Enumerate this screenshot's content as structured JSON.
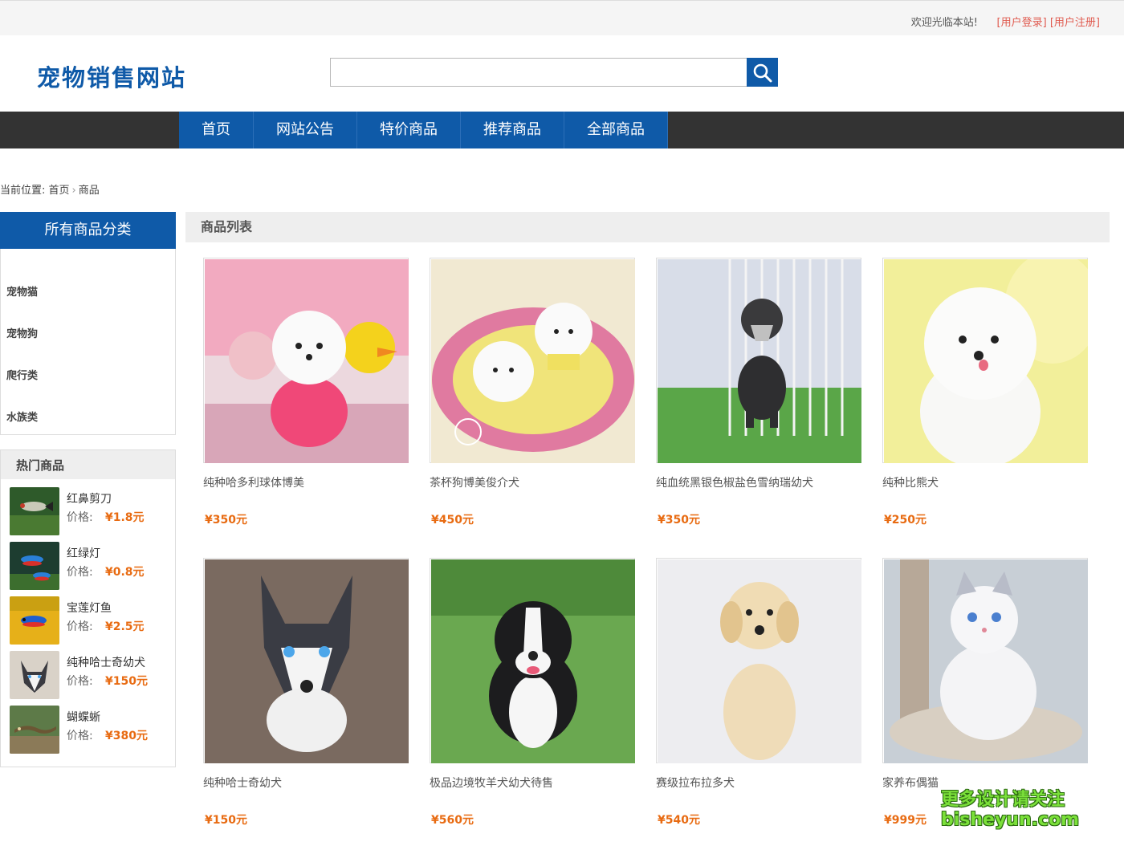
{
  "topbar": {
    "welcome": "欢迎光临本站!",
    "login_link": "[用户登录]",
    "register_link": "[用户注册]"
  },
  "header": {
    "logo_text": "宠物销售网站",
    "search_placeholder": "",
    "search_icon": "search-icon"
  },
  "nav": {
    "items": [
      "首页",
      "网站公告",
      "特价商品",
      "推荐商品",
      "全部商品"
    ]
  },
  "breadcrumb": {
    "prefix": "当前位置:",
    "home": "首页",
    "current": "商品"
  },
  "categories": {
    "title": "所有商品分类",
    "items": [
      "宠物猫",
      "宠物狗",
      "爬行类",
      "水族类"
    ]
  },
  "hot": {
    "title": "热门商品",
    "price_label": "价格:",
    "items": [
      {
        "name": "红鼻剪刀",
        "price": "¥1.8元"
      },
      {
        "name": "红绿灯",
        "price": "¥0.8元"
      },
      {
        "name": "宝莲灯鱼",
        "price": "¥2.5元"
      },
      {
        "name": "纯种哈士奇幼犬",
        "price": "¥150元"
      },
      {
        "name": "蝴蝶蜥",
        "price": "¥380元"
      }
    ]
  },
  "product_list": {
    "title": "商品列表",
    "items": [
      {
        "name": "纯种哈多利球体博美",
        "price": "¥350元"
      },
      {
        "name": "茶杯狗博美俊介犬",
        "price": "¥450元"
      },
      {
        "name": "纯血统黑银色椒盐色雪纳瑞幼犬",
        "price": "¥350元"
      },
      {
        "name": "纯种比熊犬",
        "price": "¥250元"
      },
      {
        "name": "纯种哈士奇幼犬",
        "price": "¥150元"
      },
      {
        "name": "极品边境牧羊犬幼犬待售",
        "price": "¥560元"
      },
      {
        "name": "赛级拉布拉多犬",
        "price": "¥540元"
      },
      {
        "name": "家养布偶猫",
        "price": "¥999元"
      }
    ]
  },
  "watermark": {
    "line1": "更多设计请关注",
    "line2": "bisheyun.com"
  },
  "colors": {
    "brand_blue": "#0f5aa8",
    "nav_bg": "#333333",
    "price_orange": "#e86b12",
    "link_red": "#e05a4f"
  }
}
